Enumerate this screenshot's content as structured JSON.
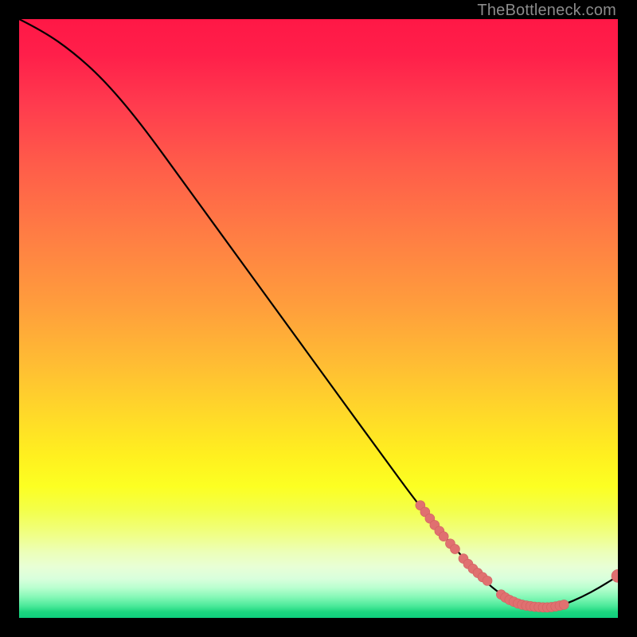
{
  "watermark": "TheBottleneck.com",
  "colors": {
    "curve_stroke": "#000000",
    "marker_fill": "#e07070",
    "marker_stroke": "#d06060",
    "marker_radius_small": 6,
    "marker_radius_end": 8
  },
  "chart_data": {
    "type": "line",
    "title": "",
    "xlabel": "",
    "ylabel": "",
    "xlim": [
      0,
      100
    ],
    "ylim": [
      0,
      100
    ],
    "grid": false,
    "legend": false,
    "note": "Axes are unlabeled in the source image. x and y below are in percent of the plot area (0–100). y is measured with 0 at the bottom (green) and 100 at the top (red). The curve is a smooth path starting top-left, descending, bottoming near x≈85–90, then rising slightly toward the right edge.",
    "curve_points": [
      {
        "x": 0,
        "y": 100
      },
      {
        "x": 4,
        "y": 98
      },
      {
        "x": 9,
        "y": 94.5
      },
      {
        "x": 14,
        "y": 90
      },
      {
        "x": 20,
        "y": 83
      },
      {
        "x": 28,
        "y": 72
      },
      {
        "x": 36,
        "y": 61
      },
      {
        "x": 44,
        "y": 50
      },
      {
        "x": 52,
        "y": 39
      },
      {
        "x": 60,
        "y": 28
      },
      {
        "x": 67,
        "y": 18.5
      },
      {
        "x": 72,
        "y": 12.5
      },
      {
        "x": 76,
        "y": 8
      },
      {
        "x": 79,
        "y": 5
      },
      {
        "x": 82,
        "y": 3
      },
      {
        "x": 85,
        "y": 2
      },
      {
        "x": 88,
        "y": 1.7
      },
      {
        "x": 91,
        "y": 2.2
      },
      {
        "x": 94,
        "y": 3.5
      },
      {
        "x": 97,
        "y": 5.1
      },
      {
        "x": 100,
        "y": 7
      }
    ],
    "marker_clusters": [
      {
        "comment": "Upper cluster on the descending slope",
        "points": [
          {
            "x": 67.0,
            "y": 18.8
          },
          {
            "x": 67.8,
            "y": 17.7
          },
          {
            "x": 68.6,
            "y": 16.6
          },
          {
            "x": 69.4,
            "y": 15.5
          },
          {
            "x": 70.2,
            "y": 14.5
          },
          {
            "x": 70.9,
            "y": 13.6
          },
          {
            "x": 72.0,
            "y": 12.4
          },
          {
            "x": 72.8,
            "y": 11.5
          }
        ]
      },
      {
        "comment": "Lower cluster approaching the trough",
        "points": [
          {
            "x": 74.2,
            "y": 9.9
          },
          {
            "x": 75.0,
            "y": 9.0
          },
          {
            "x": 75.8,
            "y": 8.2
          },
          {
            "x": 76.6,
            "y": 7.5
          },
          {
            "x": 77.4,
            "y": 6.8
          },
          {
            "x": 78.2,
            "y": 6.2
          }
        ]
      },
      {
        "comment": "Dense run of markers along the trough/tick region",
        "points": [
          {
            "x": 80.5,
            "y": 3.9
          },
          {
            "x": 81.2,
            "y": 3.4
          },
          {
            "x": 81.9,
            "y": 3.0
          },
          {
            "x": 82.6,
            "y": 2.7
          },
          {
            "x": 83.3,
            "y": 2.4
          },
          {
            "x": 84.0,
            "y": 2.2
          },
          {
            "x": 84.7,
            "y": 2.05
          },
          {
            "x": 85.4,
            "y": 1.95
          },
          {
            "x": 86.1,
            "y": 1.85
          },
          {
            "x": 86.8,
            "y": 1.8
          },
          {
            "x": 87.5,
            "y": 1.75
          },
          {
            "x": 88.2,
            "y": 1.75
          },
          {
            "x": 88.9,
            "y": 1.8
          },
          {
            "x": 89.6,
            "y": 1.9
          },
          {
            "x": 90.3,
            "y": 2.05
          },
          {
            "x": 91.0,
            "y": 2.2
          }
        ]
      }
    ],
    "end_marker": {
      "x": 100,
      "y": 7
    }
  }
}
